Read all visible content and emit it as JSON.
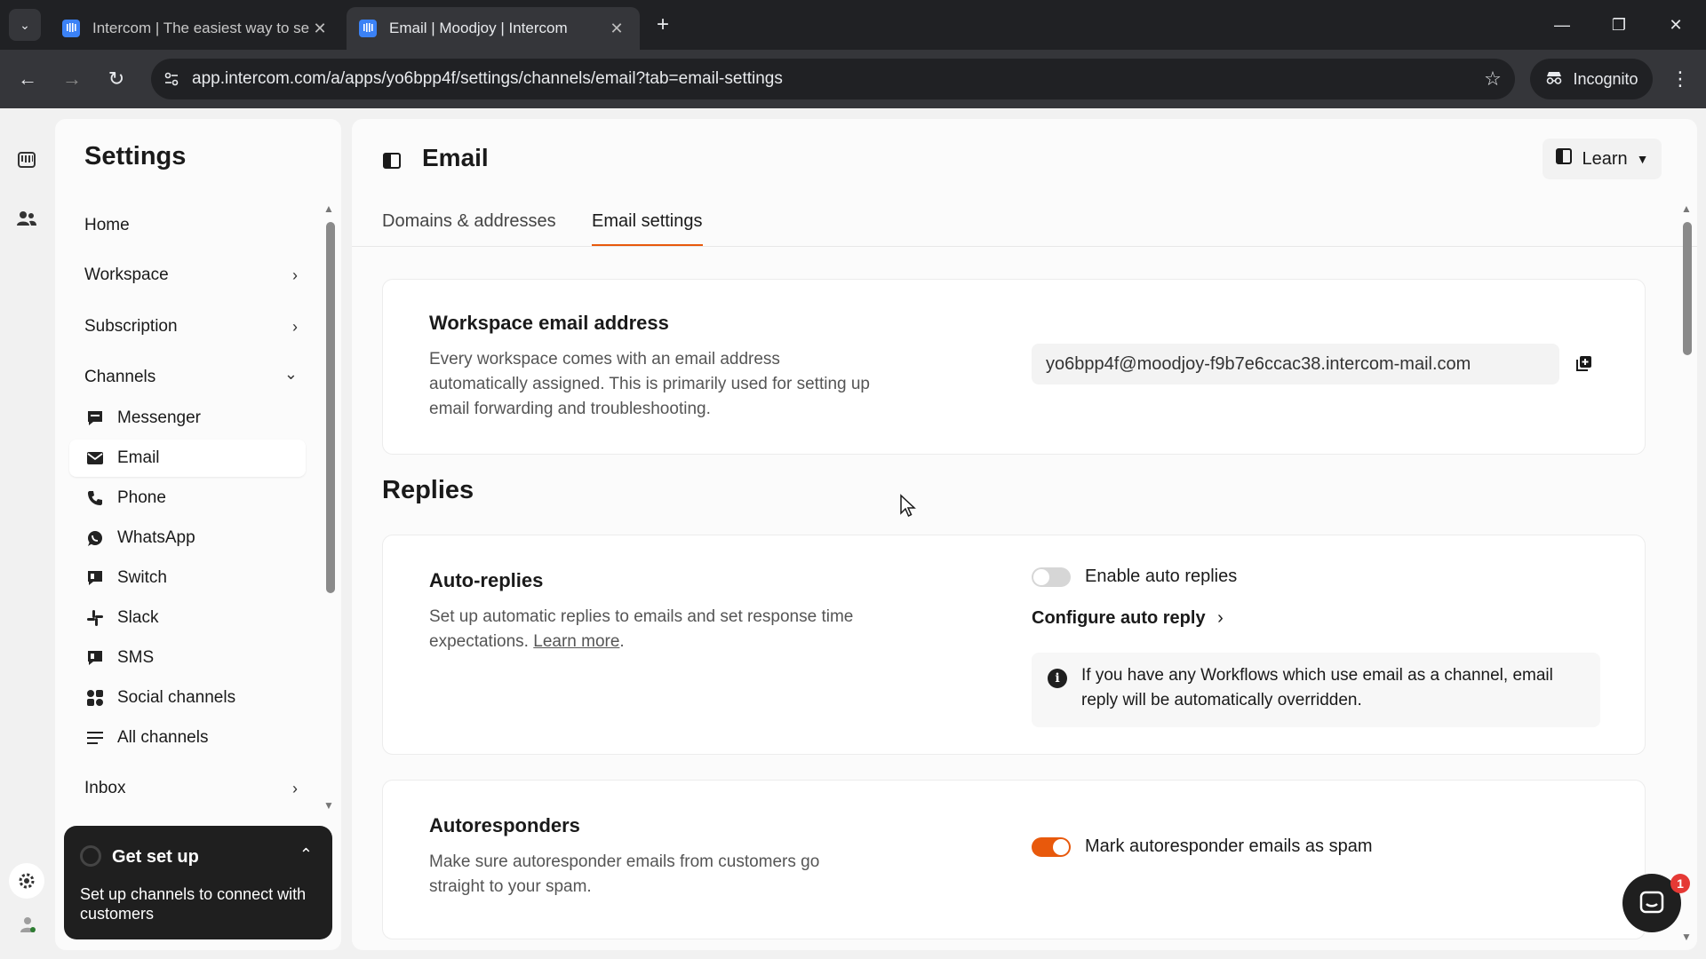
{
  "browser": {
    "tabs": [
      {
        "title": "Intercom | The easiest way to se",
        "active": false
      },
      {
        "title": "Email | Moodjoy | Intercom",
        "active": true
      }
    ],
    "url": "app.intercom.com/a/apps/yo6bpp4f/settings/channels/email?tab=email-settings",
    "incognito_label": "Incognito"
  },
  "sidebar": {
    "title": "Settings",
    "items": [
      {
        "label": "Home",
        "chevron": ""
      },
      {
        "label": "Workspace",
        "chevron": "›"
      },
      {
        "label": "Subscription",
        "chevron": "›"
      },
      {
        "label": "Channels",
        "chevron": "⌄"
      }
    ],
    "channels": [
      {
        "label": "Messenger",
        "icon": "messenger-icon"
      },
      {
        "label": "Email",
        "icon": "email-icon",
        "selected": true
      },
      {
        "label": "Phone",
        "icon": "phone-icon"
      },
      {
        "label": "WhatsApp",
        "icon": "whatsapp-icon"
      },
      {
        "label": "Switch",
        "icon": "switch-icon"
      },
      {
        "label": "Slack",
        "icon": "slack-icon"
      },
      {
        "label": "SMS",
        "icon": "sms-icon"
      },
      {
        "label": "Social channels",
        "icon": "social-channels-icon"
      },
      {
        "label": "All channels",
        "icon": "all-channels-icon"
      }
    ],
    "inbox": {
      "label": "Inbox",
      "chevron": "›"
    }
  },
  "get_set_up": {
    "title": "Get set up",
    "text": "Set up channels to connect with customers"
  },
  "main": {
    "title": "Email",
    "learn_label": "Learn",
    "tabs": [
      {
        "label": "Domains & addresses",
        "active": false
      },
      {
        "label": "Email settings",
        "active": true
      }
    ],
    "workspace_email": {
      "title": "Workspace email address",
      "description": "Every workspace comes with an email address automatically assigned. This is primarily used for setting up email forwarding and troubleshooting.",
      "address": "yo6bpp4f@moodjoy-f9b7e6ccac38.intercom-mail.com"
    },
    "replies_heading": "Replies",
    "auto_replies": {
      "title": "Auto-replies",
      "description": "Set up automatic replies to emails and set response time expectations.",
      "learn_more": "Learn more",
      "toggle_label": "Enable auto replies",
      "toggle_on": false,
      "configure_label": "Configure auto reply",
      "notice": "If you have any Workflows which use email as a channel, email reply will be automatically overridden."
    },
    "autoresponders": {
      "title": "Autoresponders",
      "description": "Make sure autoresponder emails from customers go straight to your spam.",
      "toggle_label": "Mark autoresponder emails as spam",
      "toggle_on": true
    }
  },
  "messenger": {
    "badge_count": "1"
  },
  "colors": {
    "accent": "#e8590c",
    "chrome_dark": "#202124",
    "chrome_mid": "#35363a",
    "panel_bg": "#fbfbfb",
    "page_bg": "#f1f1f1"
  }
}
